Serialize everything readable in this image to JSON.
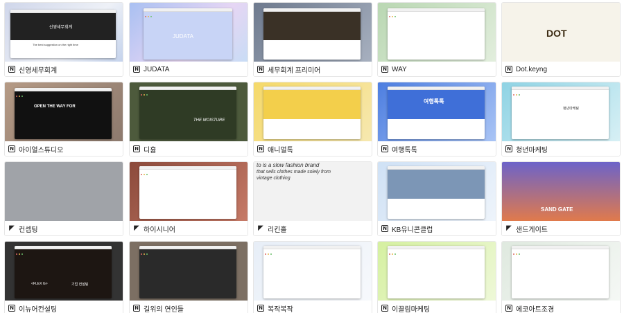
{
  "cards": [
    {
      "title": "신영세무회계",
      "tool": "notion"
    },
    {
      "title": "JUDATA",
      "tool": "notion"
    },
    {
      "title": "세무회계 프리미어",
      "tool": "notion"
    },
    {
      "title": "WAY",
      "tool": "notion"
    },
    {
      "title": "Dot.keyng",
      "tool": "notion"
    },
    {
      "title": "아이얼스튜디오",
      "tool": "notion"
    },
    {
      "title": "디흄",
      "tool": "notion"
    },
    {
      "title": "애니멀톡",
      "tool": "notion"
    },
    {
      "title": "여행톡톡",
      "tool": "notion"
    },
    {
      "title": "청년마케팅",
      "tool": "notion"
    },
    {
      "title": "컨셉팅",
      "tool": "framer"
    },
    {
      "title": "하이시니어",
      "tool": "framer"
    },
    {
      "title": "리킨홀",
      "tool": "framer"
    },
    {
      "title": "KB유니콘클럽",
      "tool": "notion"
    },
    {
      "title": "샌드게이트",
      "tool": "framer"
    },
    {
      "title": "이뉴어컨설팅",
      "tool": "notion"
    },
    {
      "title": "길위의 연인들",
      "tool": "notion"
    },
    {
      "title": "복작복작",
      "tool": "notion"
    },
    {
      "title": "이끌림마케팅",
      "tool": "notion"
    },
    {
      "title": "에코아트조경",
      "tool": "notion"
    }
  ],
  "icons": {
    "notion": "N",
    "framer": "◤"
  },
  "thumb_text": {
    "t0_brand": "신영세무회계",
    "t0_tag": "The best suggestion on the right time",
    "t1_brand": "JUDATA",
    "t4_logo": "DOT",
    "t5_headline": "OPEN THE WAY FOR",
    "t6_brand": "THE MOISTURE",
    "t9_name": "청년마케팅",
    "t12_headline": "that sells clothes made solely from vintage clothing",
    "t12_top": "to is a slow fashion brand",
    "t14_brand": "SAND GATE",
    "t15_flex": "<FLEX G>",
    "t15_btn2": "기업 컨설팅",
    "t8_brand": "여행톡톡"
  }
}
